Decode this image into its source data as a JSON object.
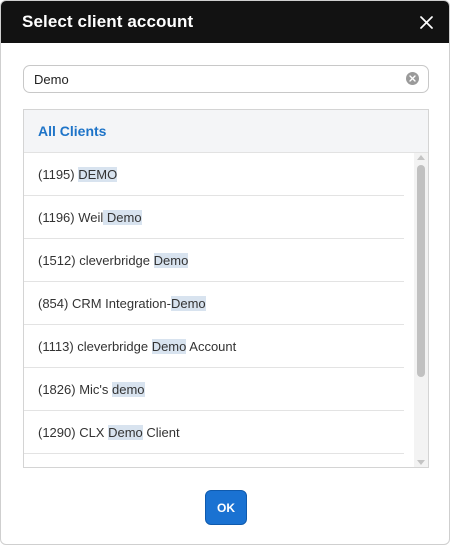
{
  "dialog": {
    "title": "Select client account"
  },
  "search": {
    "value": "Demo"
  },
  "list": {
    "header": "All Clients",
    "items": [
      {
        "pre": "(1195) ",
        "match": "DEMO",
        "post": ""
      },
      {
        "pre": "(1196) Weil",
        "match": " Demo",
        "post": ""
      },
      {
        "pre": "(1512) cleverbridge ",
        "match": "Demo",
        "post": ""
      },
      {
        "pre": "(854) CRM Integration-",
        "match": "Demo",
        "post": ""
      },
      {
        "pre": "(1113) cleverbridge ",
        "match": "Demo",
        "post": " Account"
      },
      {
        "pre": "(1826) Mic's ",
        "match": "demo",
        "post": ""
      },
      {
        "pre": "(1290) CLX ",
        "match": "Demo",
        "post": " Client"
      },
      {
        "pre": "",
        "match": "",
        "post": ""
      }
    ]
  },
  "footer": {
    "ok_label": "OK"
  },
  "colors": {
    "header_bg": "#121212",
    "accent": "#1a72d2",
    "highlight": "#d8e3ef",
    "list_header_text": "#1e74c8"
  },
  "icons": {
    "close": "close-icon",
    "clear": "clear-icon"
  }
}
